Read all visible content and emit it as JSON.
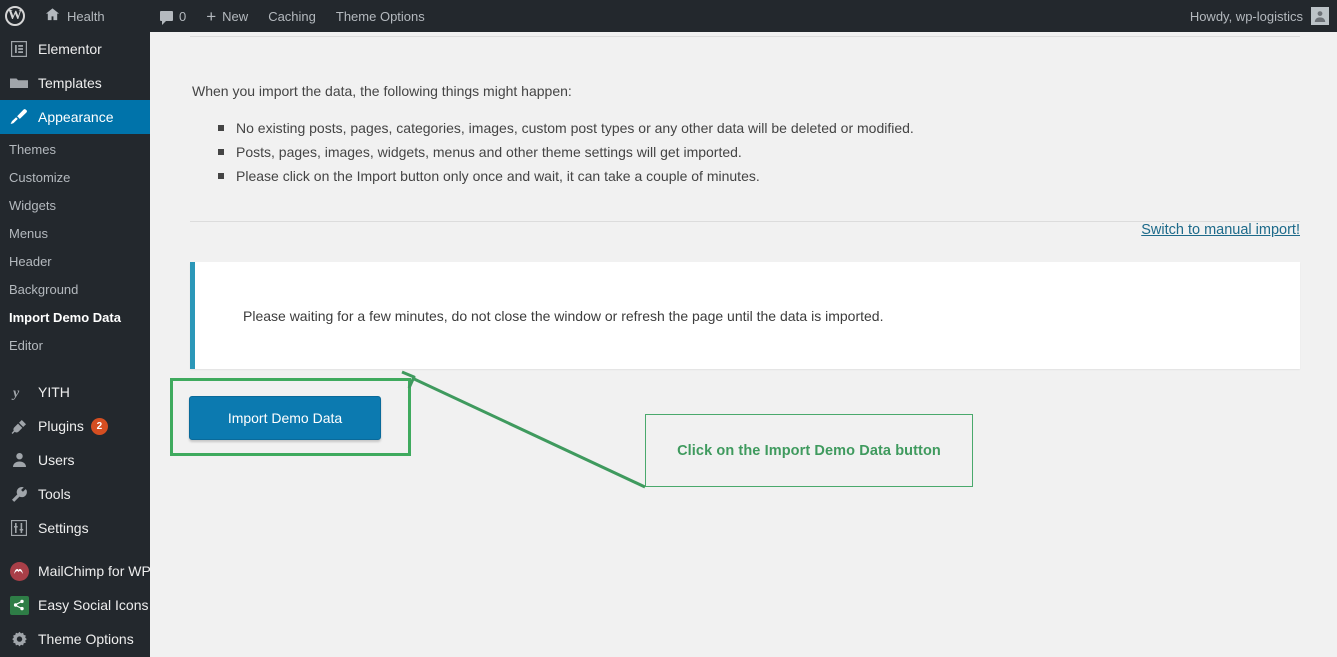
{
  "adminbar": {
    "comment_count": "0",
    "new_label": "New",
    "caching_label": "Caching",
    "theme_options_label": "Theme Options",
    "howdy": "Howdy, wp-logistics",
    "wp_logo": "wordpress-logo-icon",
    "avatar": "user-avatar-icon"
  },
  "sidebar": {
    "health_label": "Health",
    "items": [
      {
        "label": "Elementor",
        "icon": "elementor-icon",
        "current": false
      },
      {
        "label": "Templates",
        "icon": "folder-icon",
        "current": false
      },
      {
        "label": "Appearance",
        "icon": "paintbrush-icon",
        "current": true
      }
    ],
    "submenu": [
      {
        "label": "Themes",
        "active": false
      },
      {
        "label": "Customize",
        "active": false
      },
      {
        "label": "Widgets",
        "active": false
      },
      {
        "label": "Menus",
        "active": false
      },
      {
        "label": "Header",
        "active": false
      },
      {
        "label": "Background",
        "active": false
      },
      {
        "label": "Import Demo Data",
        "active": true
      },
      {
        "label": "Editor",
        "active": false
      }
    ],
    "items2": [
      {
        "label": "YITH",
        "icon": "yith-icon",
        "badge": ""
      },
      {
        "label": "Plugins",
        "icon": "plug-icon",
        "badge": "2"
      },
      {
        "label": "Users",
        "icon": "user-icon",
        "badge": ""
      },
      {
        "label": "Tools",
        "icon": "wrench-icon",
        "badge": ""
      },
      {
        "label": "Settings",
        "icon": "sliders-icon",
        "badge": ""
      }
    ],
    "items3": [
      {
        "label": "MailChimp for WP",
        "icon": "mailchimp-icon",
        "badge": ""
      },
      {
        "label": "Easy Social Icons",
        "icon": "share-icon",
        "badge": ""
      },
      {
        "label": "Theme Options",
        "icon": "gear-icon",
        "badge": ""
      }
    ]
  },
  "main": {
    "intro": "When you import the data, the following things might happen:",
    "bullets": [
      "No existing posts, pages, categories, images, custom post types or any other data will be deleted or modified.",
      "Posts, pages, images, widgets, menus and other theme settings will get imported.",
      "Please click on the Import button only once and wait, it can take a couple of minutes."
    ],
    "manual_link": "Switch to manual import!",
    "notice_text": "Please waiting for a few minutes, do not close the window or refresh the page until the data is imported.",
    "import_button": "Import Demo Data",
    "annotation": "Click on the Import Demo Data button"
  },
  "colors": {
    "admin_dark": "#23282d",
    "accent_blue": "#0073aa",
    "button_blue": "#0c7ab0",
    "notice_teal": "#2b97b8",
    "highlight_green": "#3faa5e",
    "annotation_green": "#3f9a5e",
    "badge_orange": "#d54e21",
    "link_blue": "#1d6a8a"
  }
}
